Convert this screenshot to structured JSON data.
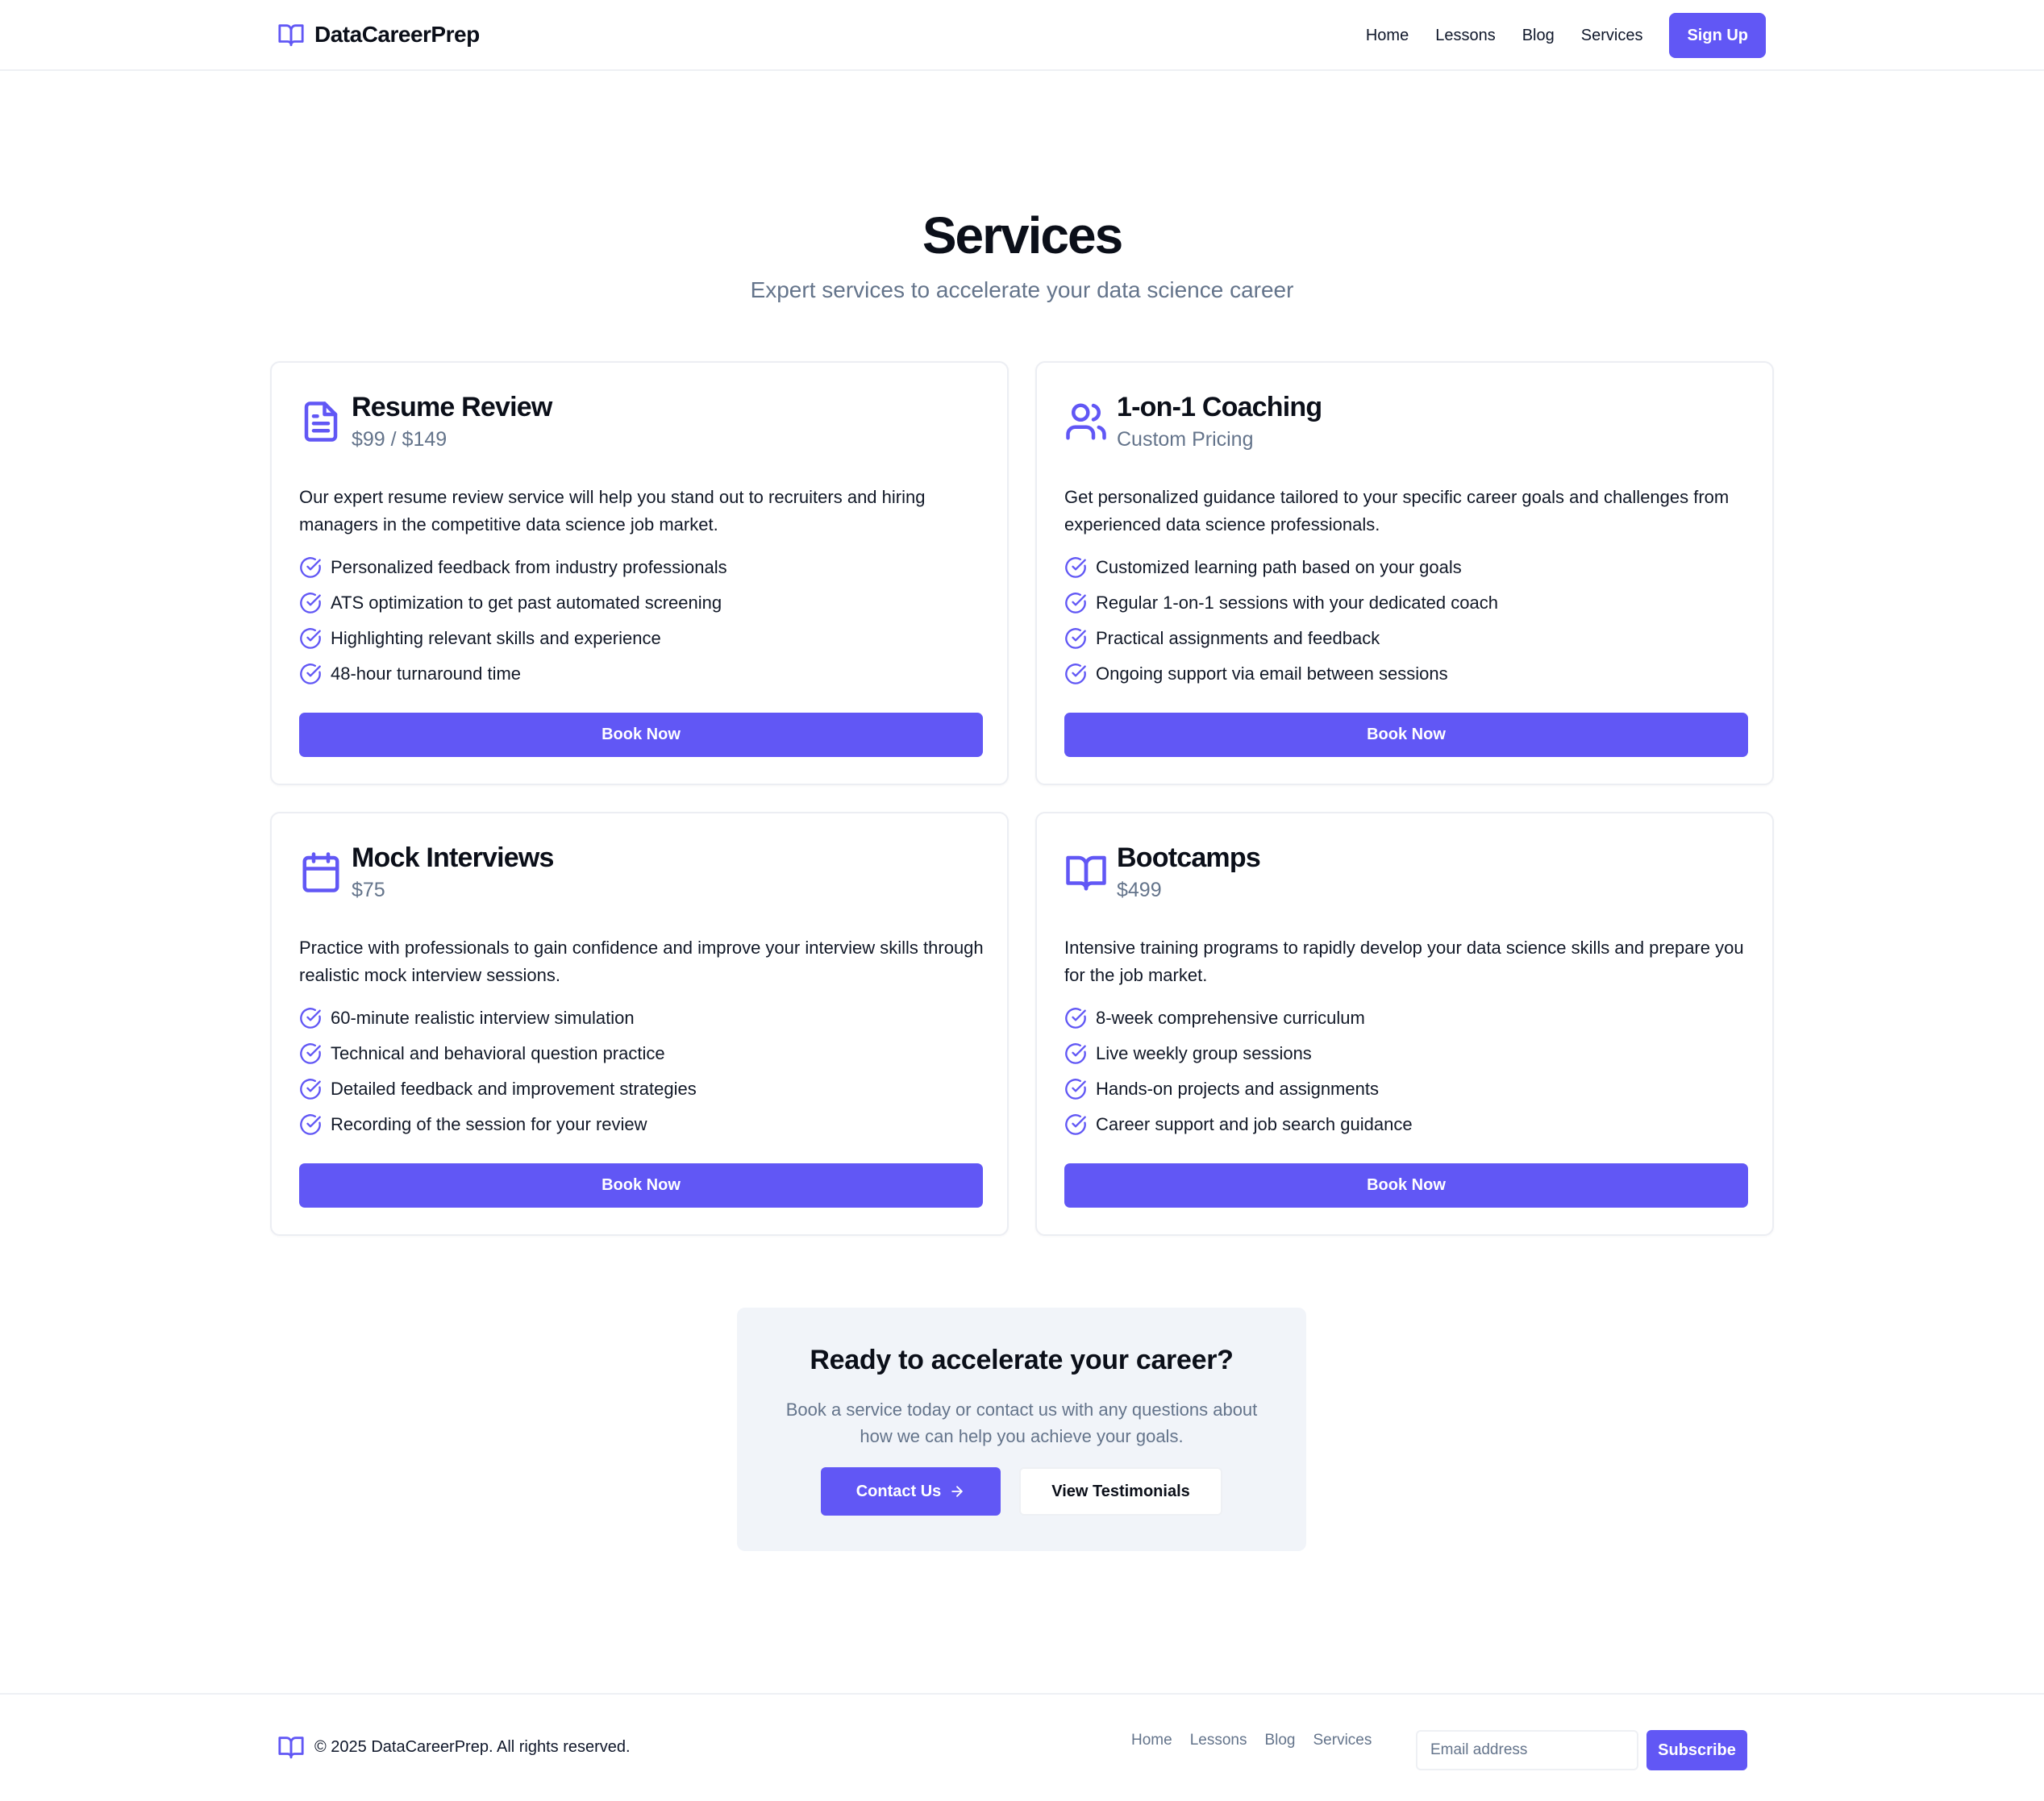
{
  "header": {
    "brand": "DataCareerPrep",
    "nav": [
      "Home",
      "Lessons",
      "Blog",
      "Services"
    ],
    "signup_label": "Sign Up"
  },
  "hero": {
    "title": "Services",
    "subtitle": "Expert services to accelerate your data science career"
  },
  "services": [
    {
      "icon": "document-icon",
      "title": "Resume Review",
      "price": "$99 / $149",
      "description": "Our expert resume review service will help you stand out to recruiters and hiring managers in the competitive data science job market.",
      "features": [
        "Personalized feedback from industry professionals",
        "ATS optimization to get past automated screening",
        "Highlighting relevant skills and experience",
        "48-hour turnaround time"
      ],
      "button": "Book Now"
    },
    {
      "icon": "users-icon",
      "title": "1-on-1 Coaching",
      "price": "Custom Pricing",
      "description": "Get personalized guidance tailored to your specific career goals and challenges from experienced data science professionals.",
      "features": [
        "Customized learning path based on your goals",
        "Regular 1-on-1 sessions with your dedicated coach",
        "Practical assignments and feedback",
        "Ongoing support via email between sessions"
      ],
      "button": "Book Now"
    },
    {
      "icon": "calendar-icon",
      "title": "Mock Interviews",
      "price": "$75",
      "description": "Practice with professionals to gain confidence and improve your interview skills through realistic mock interview sessions.",
      "features": [
        "60-minute realistic interview simulation",
        "Technical and behavioral question practice",
        "Detailed feedback and improvement strategies",
        "Recording of the session for your review"
      ],
      "button": "Book Now"
    },
    {
      "icon": "book-open-icon",
      "title": "Bootcamps",
      "price": "$499",
      "description": "Intensive training programs to rapidly develop your data science skills and prepare you for the job market.",
      "features": [
        "8-week comprehensive curriculum",
        "Live weekly group sessions",
        "Hands-on projects and assignments",
        "Career support and job search guidance"
      ],
      "button": "Book Now"
    }
  ],
  "cta": {
    "title": "Ready to accelerate your career?",
    "text": "Book a service today or contact us with any questions about how we can help you achieve your goals.",
    "contact_label": "Contact Us",
    "testimonials_label": "View Testimonials"
  },
  "footer": {
    "copyright": "© 2025 DataCareerPrep. All rights reserved.",
    "nav": [
      "Home",
      "Lessons",
      "Blog",
      "Services"
    ],
    "email_placeholder": "Email address",
    "subscribe_label": "Subscribe"
  },
  "colors": {
    "accent": "#6157f5",
    "muted_text": "#64748b",
    "cta_background": "#f1f4f9"
  }
}
